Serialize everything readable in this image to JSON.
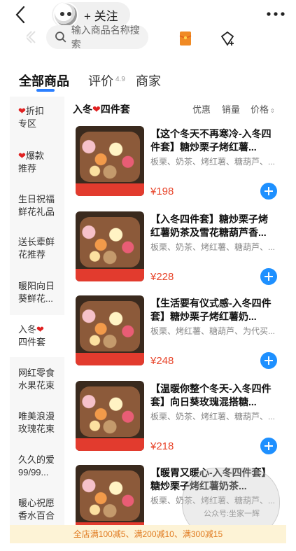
{
  "header": {
    "follow_label": "+ 关注",
    "back_icon": "chevron-left-icon",
    "more_icon": "more-dots-icon"
  },
  "search": {
    "placeholder": "输入商品名称搜索"
  },
  "tabs": [
    {
      "label": "全部商品",
      "active": true
    },
    {
      "label": "评价",
      "badge": "4.9"
    },
    {
      "label": "商家"
    }
  ],
  "sidebar": {
    "items": [
      {
        "line1": "折扣",
        "line2": "专区",
        "heart": true
      },
      {
        "line1": "爆款",
        "line2": "推荐",
        "heart": true
      },
      {
        "line1": "生日祝福",
        "line2": "鲜花礼品"
      },
      {
        "line1": "送长辈鲜",
        "line2": "花推荐"
      },
      {
        "line1": "暖阳向日",
        "line2": "葵鲜花..."
      },
      {
        "line1": "入冬",
        "line2": "四件套",
        "heart_after_line1": true,
        "active": true
      },
      {
        "line1": "网红零食",
        "line2": "水果花束"
      },
      {
        "line1": "唯美浪漫",
        "line2": "玫瑰花束"
      },
      {
        "line1": "久久的爱",
        "line2": "99/99..."
      },
      {
        "line1": "暖心祝愿",
        "line2": "香水百合"
      }
    ]
  },
  "section": {
    "title_prefix": "入冬",
    "title_suffix": "四件套",
    "sort_discount": "优惠",
    "sort_sales": "销量",
    "sort_price": "价格"
  },
  "products": [
    {
      "title": "【这个冬天不再寒冷-入冬四件套】糖炒栗子烤红薯...",
      "tags": "板栗、奶茶、烤红薯、糖葫芦、...",
      "price": "¥198"
    },
    {
      "title": "【入冬四件套】糖炒栗子烤红薯奶茶及雪花糖葫芦香...",
      "tags": "板栗、奶茶、烤红薯、糖葫芦、...",
      "price": "¥228"
    },
    {
      "title": "【生活要有仪式感-入冬四件套】糖炒栗子烤红薯奶...",
      "tags": "板栗、烤红薯、糖葫芦、为代买...",
      "price": "¥248"
    },
    {
      "title": "【温暖你整个冬天-入冬四件套】向日葵玫瑰混搭糖...",
      "tags": "板栗、奶茶、烤红薯、糖葫芦、...",
      "price": "¥218"
    },
    {
      "title": "【暖胃又暖心-入冬四件套】糖炒栗子烤红薯奶茶...",
      "tags": "板栗、奶茶、烤红薯、糖葫芦、...",
      "price": ""
    }
  ],
  "promo": "全店满100减5、满200减10、满300减15",
  "watermark": "公众号:坐家一辉"
}
